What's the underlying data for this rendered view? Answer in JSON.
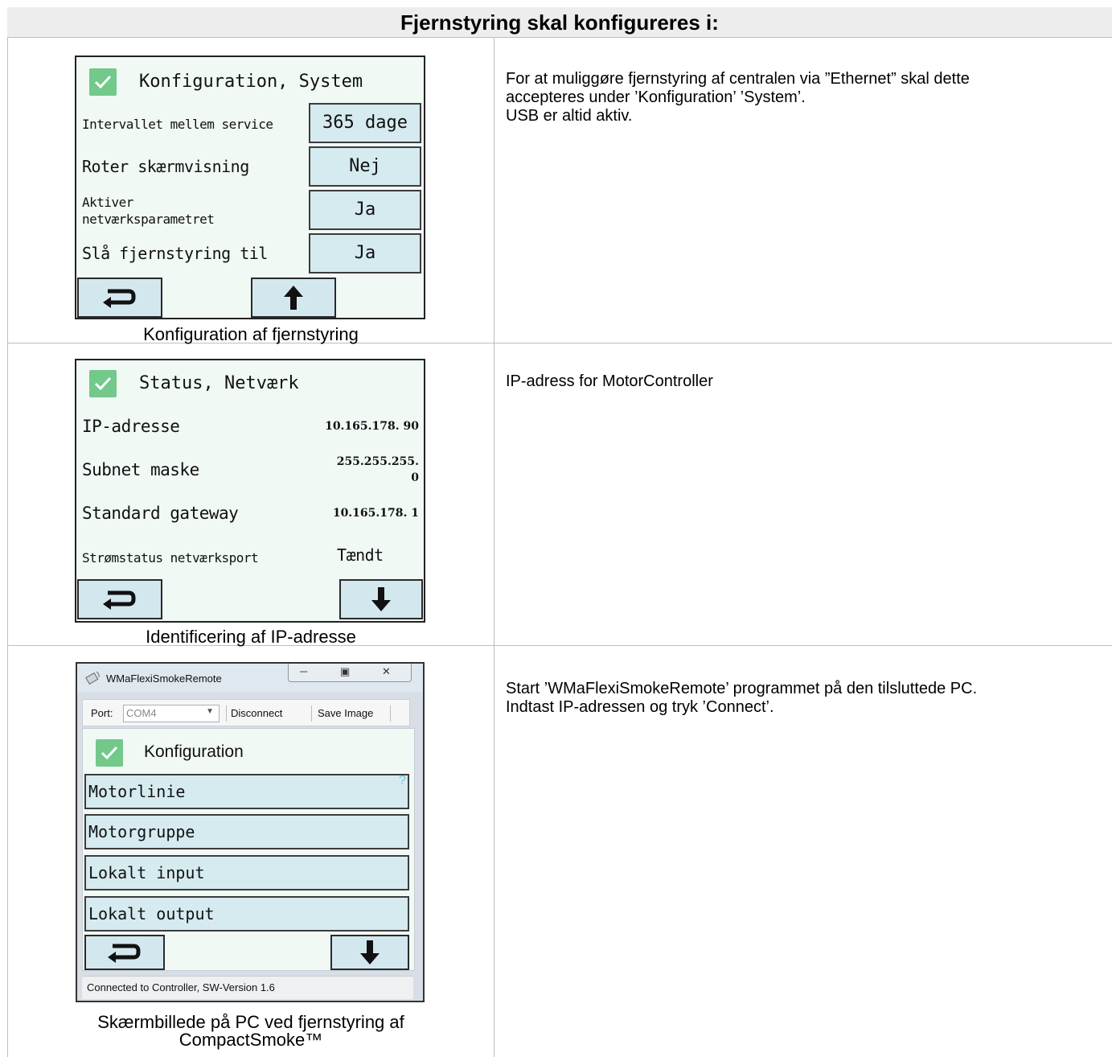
{
  "header": "Fjernstyring skal konfigureres i:",
  "row1": {
    "screen_title": "Konfiguration, System",
    "settings": [
      {
        "label": "Intervallet mellem service",
        "value": "365 dage"
      },
      {
        "label": "Roter skærmvisning",
        "value": "Nej"
      },
      {
        "label_line1": "Aktiver",
        "label_line2": "netværksparametret",
        "value": "Ja"
      },
      {
        "label": "Slå fjernstyring til",
        "value": "Ja"
      }
    ],
    "buttons": [
      "return-icon",
      "arrow-up-icon"
    ],
    "caption": "Konfiguration af fjernstyring",
    "description": [
      "For at muliggøre fjernstyring af centralen via ”Ethernet” skal dette",
      "accepteres under ’Konfiguration’ ’System’.",
      "USB er altid aktiv."
    ]
  },
  "row2": {
    "screen_title": "Status, Netværk",
    "settings": [
      {
        "label": "IP-adresse",
        "value": "10.165.178. 90"
      },
      {
        "label": "Subnet maske",
        "value_line1": "255.255.255.",
        "value_line2": "0"
      },
      {
        "label": "Standard gateway",
        "value": "10.165.178. 1"
      },
      {
        "label": "Strømstatus netværksport",
        "value": "Tændt"
      }
    ],
    "buttons": [
      "return-icon",
      "arrow-down-icon"
    ],
    "caption": "Identificering af IP-adresse",
    "description": [
      "IP-adress for MotorController"
    ]
  },
  "row3": {
    "window_title": "WMaFlexiSmokeRemote",
    "toolbar": {
      "port_label": "Port:",
      "port_value": "COM4",
      "disconnect": "Disconnect",
      "save_image": "Save Image"
    },
    "screen_title": "Konfiguration",
    "help_mark": "?",
    "menu": [
      "Motorlinie",
      "Motorgruppe",
      "Lokalt input",
      "Lokalt output"
    ],
    "buttons": [
      "return-icon",
      "arrow-down-icon"
    ],
    "status": "Connected to Controller, SW-Version 1.6",
    "caption_line1": "Skærmbillede på PC ved fjernstyring af",
    "caption_line2": "CompactSmoke™",
    "description": [
      "Start ’WMaFlexiSmokeRemote’ programmet på den tilsluttede PC.",
      "Indtast IP-adressen og tryk ’Connect’."
    ]
  },
  "colors": {
    "screen_bg": "#f1f9f4",
    "button_bg": "#d6ebef",
    "check_green": "#72c98a",
    "header_bg": "#ededed"
  }
}
